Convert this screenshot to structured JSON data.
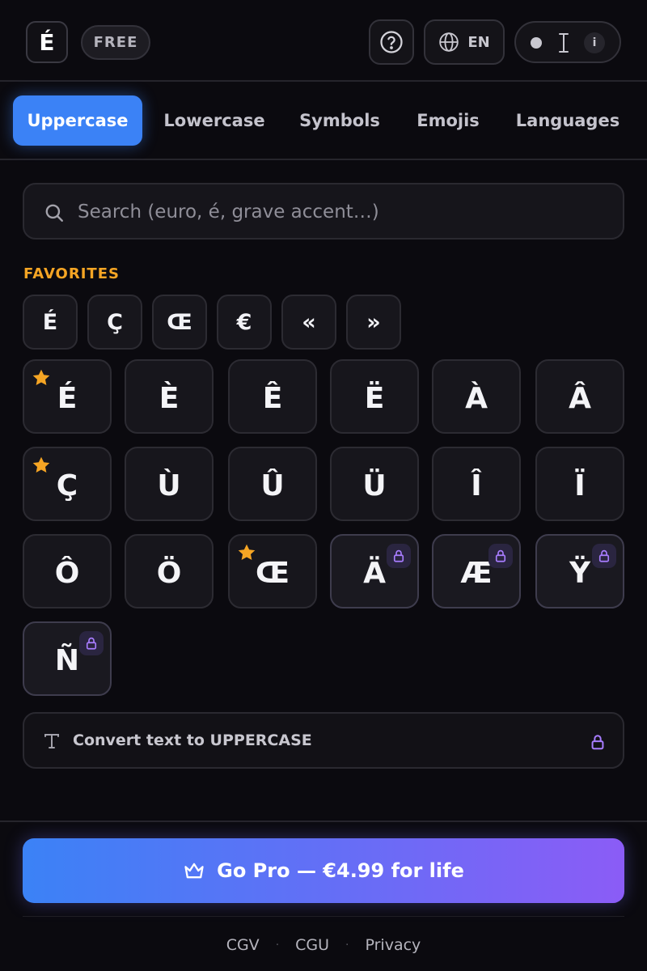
{
  "header": {
    "logo": "É",
    "badge": "FREE",
    "language": "EN",
    "mode_info": "i"
  },
  "tabs": [
    {
      "label": "Uppercase",
      "active": true
    },
    {
      "label": "Lowercase",
      "active": false
    },
    {
      "label": "Symbols",
      "active": false
    },
    {
      "label": "Emojis",
      "active": false
    },
    {
      "label": "Languages",
      "active": false
    }
  ],
  "search": {
    "placeholder": "Search (euro, é, grave accent…)",
    "value": ""
  },
  "favorites": {
    "heading": "FAVORITES",
    "items": [
      "É",
      "Ç",
      "Œ",
      "€",
      "«",
      "»"
    ]
  },
  "characters": [
    {
      "char": "É",
      "favorite": true,
      "locked": false
    },
    {
      "char": "È",
      "favorite": false,
      "locked": false
    },
    {
      "char": "Ê",
      "favorite": false,
      "locked": false
    },
    {
      "char": "Ë",
      "favorite": false,
      "locked": false
    },
    {
      "char": "À",
      "favorite": false,
      "locked": false
    },
    {
      "char": "Â",
      "favorite": false,
      "locked": false
    },
    {
      "char": "Ç",
      "favorite": true,
      "locked": false
    },
    {
      "char": "Ù",
      "favorite": false,
      "locked": false
    },
    {
      "char": "Û",
      "favorite": false,
      "locked": false
    },
    {
      "char": "Ü",
      "favorite": false,
      "locked": false
    },
    {
      "char": "Î",
      "favorite": false,
      "locked": false
    },
    {
      "char": "Ï",
      "favorite": false,
      "locked": false
    },
    {
      "char": "Ô",
      "favorite": false,
      "locked": false
    },
    {
      "char": "Ö",
      "favorite": false,
      "locked": false
    },
    {
      "char": "Œ",
      "favorite": true,
      "locked": false
    },
    {
      "char": "Ä",
      "favorite": false,
      "locked": true
    },
    {
      "char": "Æ",
      "favorite": false,
      "locked": true
    },
    {
      "char": "Ÿ",
      "favorite": false,
      "locked": true
    },
    {
      "char": "Ñ",
      "favorite": false,
      "locked": true
    }
  ],
  "convert": {
    "label": "Convert text to UPPERCASE",
    "locked": true
  },
  "cta": {
    "label": "Go Pro — €4.99 for life"
  },
  "footer": {
    "links": [
      "CGV",
      "CGU",
      "Privacy"
    ],
    "separator": "·"
  },
  "colors": {
    "accent": "#3b82f6",
    "accent_end": "#8b5cf6",
    "favorite": "#f5a524",
    "lock": "#a87dff",
    "background": "#0b0a0f"
  },
  "icons": {
    "help": "question-circle-icon",
    "language": "globe-icon",
    "search": "search-icon",
    "favorite": "star-icon",
    "lock": "lock-icon",
    "convert": "text-type-icon",
    "cta": "crown-icon"
  }
}
